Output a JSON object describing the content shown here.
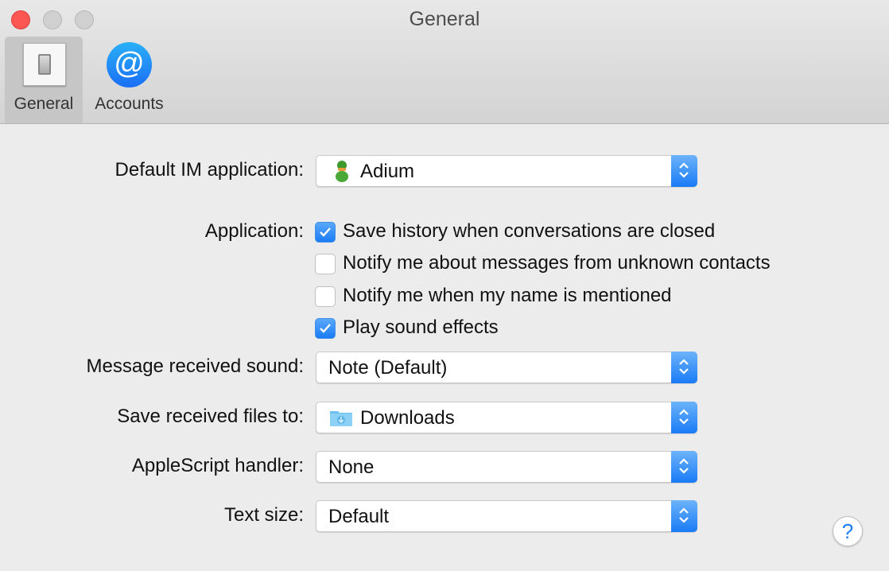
{
  "window": {
    "title": "General"
  },
  "toolbar": {
    "items": [
      {
        "label": "General",
        "icon": "switch-icon",
        "selected": true
      },
      {
        "label": "Accounts",
        "icon": "at-sign-icon",
        "selected": false
      }
    ]
  },
  "settings": {
    "default_im": {
      "label": "Default IM application:",
      "value": "Adium",
      "icon": "adium-duck-icon"
    },
    "application": {
      "label": "Application:",
      "options": [
        {
          "label": "Save history when conversations are closed",
          "checked": true
        },
        {
          "label": "Notify me about messages from unknown contacts",
          "checked": false
        },
        {
          "label": "Notify me when my name is mentioned",
          "checked": false
        },
        {
          "label": "Play sound effects",
          "checked": true
        }
      ]
    },
    "message_sound": {
      "label": "Message received sound:",
      "value": "Note (Default)"
    },
    "save_files": {
      "label": "Save received files to:",
      "value": "Downloads",
      "icon": "downloads-folder-icon"
    },
    "applescript": {
      "label": "AppleScript handler:",
      "value": "None"
    },
    "text_size": {
      "label": "Text size:",
      "value": "Default"
    }
  },
  "help": {
    "symbol": "?"
  },
  "colors": {
    "accent": "#1a7cf6",
    "close": "#fc5753"
  }
}
